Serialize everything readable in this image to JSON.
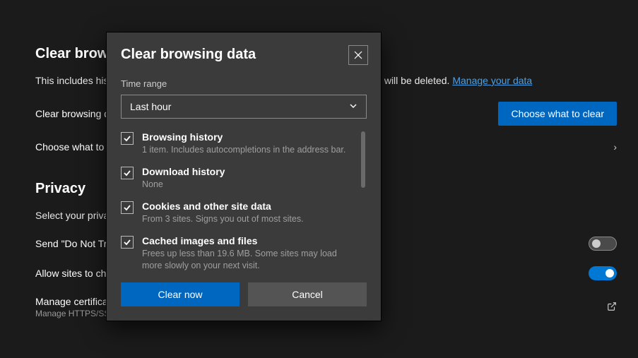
{
  "background": {
    "section1_title": "Clear browsing data",
    "section1_sub_prefix": "This includes history, passwords, cookies, and more. Only data from this profile will be deleted. ",
    "section1_link": "Manage your data",
    "row_clear_now_label": "Clear browsing data now",
    "btn_choose": "Choose what to clear",
    "row_choose_exit": "Choose what to clear every time you close the browser",
    "section2_title": "Privacy",
    "section2_sub": "Select your privacy settings for Microsoft Edge.",
    "row_dnt": "Send \"Do Not Track\" requests",
    "row_allow_sites": "Allow sites to check if you have payment methods saved",
    "row_certs_title": "Manage certificates",
    "row_certs_sub": "Manage HTTPS/SSL certificates and settings"
  },
  "modal": {
    "title": "Clear browsing data",
    "time_range_label": "Time range",
    "time_range_value": "Last hour",
    "options": [
      {
        "title": "Browsing history",
        "sub": "1 item. Includes autocompletions in the address bar.",
        "checked": true
      },
      {
        "title": "Download history",
        "sub": "None",
        "checked": true
      },
      {
        "title": "Cookies and other site data",
        "sub": "From 3 sites. Signs you out of most sites.",
        "checked": true
      },
      {
        "title": "Cached images and files",
        "sub": "Frees up less than 19.6 MB. Some sites may load more slowly on your next visit.",
        "checked": true
      }
    ],
    "btn_clear": "Clear now",
    "btn_cancel": "Cancel"
  }
}
